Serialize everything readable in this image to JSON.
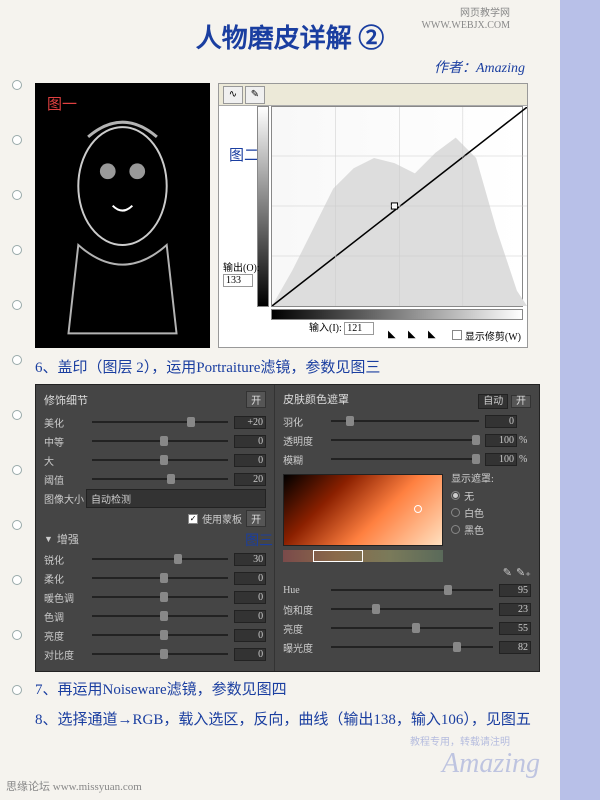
{
  "watermark_top": {
    "line1": "网页教学网",
    "line2": "WWW.WEBJX.COM"
  },
  "title": "人物磨皮详解 ②",
  "author": "作者：Amazing",
  "img1_label": "图一",
  "img2_label": "图二",
  "curves": {
    "output_label": "输出(O):",
    "output_value": "133",
    "input_label": "输入(I):",
    "input_value": "121",
    "show_clip": "显示修剪(W)"
  },
  "step6": "6、盖印（图层 2），运用Portraiture滤镜，参数见图三",
  "img3_label": "图三",
  "panel": {
    "left_title": "修饰细节",
    "right_title": "皮肤颜色遮罩",
    "auto": "自动",
    "on": "开",
    "left_sliders": [
      {
        "label": "美化",
        "value": "+20",
        "pos": 70
      },
      {
        "label": "中等",
        "value": "0",
        "pos": 50
      },
      {
        "label": "大",
        "value": "0",
        "pos": 50
      },
      {
        "label": "阈值",
        "value": "20",
        "pos": 55
      }
    ],
    "image_size_label": "图像大小",
    "image_size_value": "自动检测",
    "use_mask": "使用蒙板",
    "enhance_label": "增强",
    "enhance_sliders": [
      {
        "label": "锐化",
        "value": "30",
        "pos": 60
      },
      {
        "label": "柔化",
        "value": "0",
        "pos": 50
      },
      {
        "label": "暖色调",
        "value": "0",
        "pos": 50
      },
      {
        "label": "色调",
        "value": "0",
        "pos": 50
      },
      {
        "label": "亮度",
        "value": "0",
        "pos": 50
      },
      {
        "label": "对比度",
        "value": "0",
        "pos": 50
      }
    ],
    "right_sliders_top": [
      {
        "label": "羽化",
        "value": "0",
        "suffix": "",
        "pos": 10
      },
      {
        "label": "透明度",
        "value": "100",
        "suffix": "%",
        "pos": 95
      },
      {
        "label": "模糊",
        "value": "100",
        "suffix": "%",
        "pos": 95
      }
    ],
    "show_mask_label": "显示遮罩:",
    "radios": [
      {
        "label": "无",
        "checked": true
      },
      {
        "label": "白色",
        "checked": false
      },
      {
        "label": "黑色",
        "checked": false
      }
    ],
    "right_sliders_bottom": [
      {
        "label": "Hue",
        "value": "95",
        "pos": 70
      },
      {
        "label": "饱和度",
        "value": "23",
        "pos": 25
      },
      {
        "label": "亮度",
        "value": "55",
        "pos": 50
      },
      {
        "label": "曝光度",
        "value": "82",
        "pos": 75
      }
    ]
  },
  "step7": "7、再运用Noiseware滤镜，参数见图四",
  "step8": "8、选择通道→RGB，载入选区，反向，曲线（输出138，输入106），见图五",
  "footer": "思缘论坛  www.missyuan.com",
  "wm_sub": "教程专用，转载请注明",
  "wm_main": "Amazing"
}
